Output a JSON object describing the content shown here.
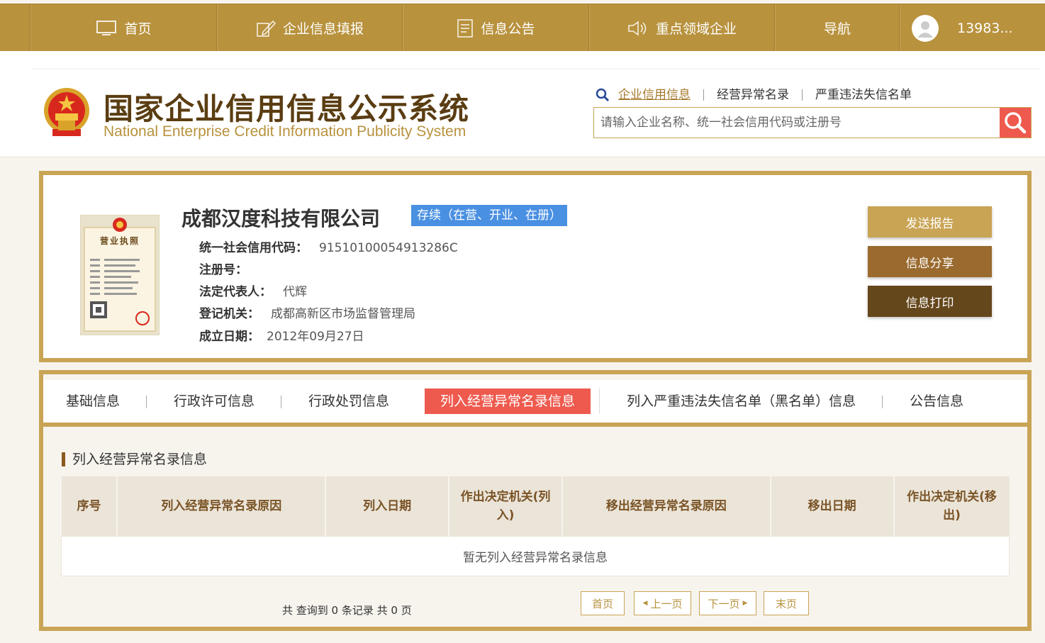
{
  "topnav": {
    "items": [
      {
        "label": "首页",
        "icon": "monitor-icon"
      },
      {
        "label": "企业信息填报",
        "icon": "edit-icon"
      },
      {
        "label": "信息公告",
        "icon": "document-icon"
      },
      {
        "label": "重点领域企业",
        "icon": "speaker-icon"
      },
      {
        "label": "导航"
      }
    ],
    "user": "13983..."
  },
  "header": {
    "title": "国家企业信用信息公示系统",
    "subtitle": "National Enterprise Credit Information Publicity System",
    "search_tabs": [
      "企业信用信息",
      "经营异常名录",
      "严重违法失信名单"
    ],
    "search_placeholder": "请输入企业名称、统一社会信用代码或注册号"
  },
  "company": {
    "name": "成都汉度科技有限公司",
    "status": "存续（在营、开业、在册）",
    "fields": [
      {
        "label": "统一社会信用代码：",
        "value": "91510100054913286C"
      },
      {
        "label": "注册号：",
        "value": ""
      },
      {
        "label": "法定代表人：",
        "value": "代辉"
      },
      {
        "label": "登记机关：",
        "value": "成都高新区市场监督管理局"
      },
      {
        "label": "成立日期：",
        "value": "2012年09月27日"
      }
    ],
    "license_title": "营业执照",
    "actions": [
      "发送报告",
      "信息分享",
      "信息打印"
    ],
    "action_colors": [
      "#c9a455",
      "#9a6a2e",
      "#65471c"
    ]
  },
  "tabs": [
    "基础信息",
    "行政许可信息",
    "行政处罚信息",
    "列入经营异常名录信息",
    "列入严重违法失信名单（黑名单）信息",
    "公告信息"
  ],
  "active_tab": 3,
  "section": {
    "title": "列入经营异常名录信息",
    "columns": [
      "序号",
      "列入经营异常名录原因",
      "列入日期",
      "作出决定机关(列入)",
      "移出经营异常名录原因",
      "移出日期",
      "作出决定机关(移出)"
    ],
    "empty_text": "暂无列入经营异常名录信息"
  },
  "pager": {
    "info": "共 查询到 0 条记录 共 0 页",
    "first": "首页",
    "prev": "上一页",
    "next": "下一页",
    "last": "末页"
  },
  "colors": {
    "gold": "#b8923d",
    "accent_red": "#ee5a4e",
    "status_blue": "#4a90e2"
  }
}
